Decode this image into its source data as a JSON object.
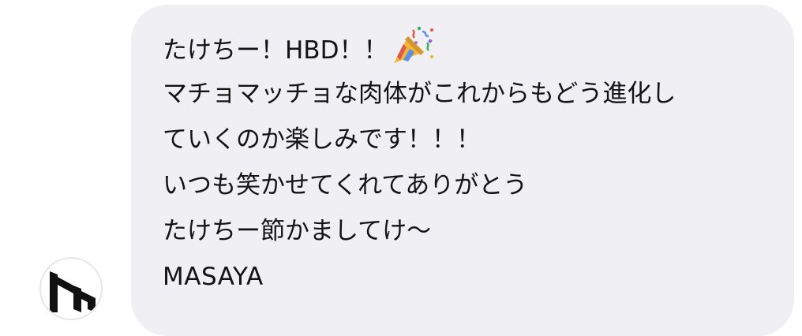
{
  "message": {
    "lines": [
      "たけちー！HBD！！",
      "マチョマッチョな肉体がこれからもどう進化し",
      "ていくのか楽しみです！！！",
      "いつも笑かせてくれてありがとう",
      "たけちー節かましてけ～"
    ],
    "emoji": "party-popper-icon",
    "signature": "MASAYA"
  },
  "avatar": {
    "icon": "logo-icon"
  },
  "colors": {
    "bubble": "#efeff4",
    "text": "#141414",
    "avatar_border": "#e6e6ea"
  }
}
